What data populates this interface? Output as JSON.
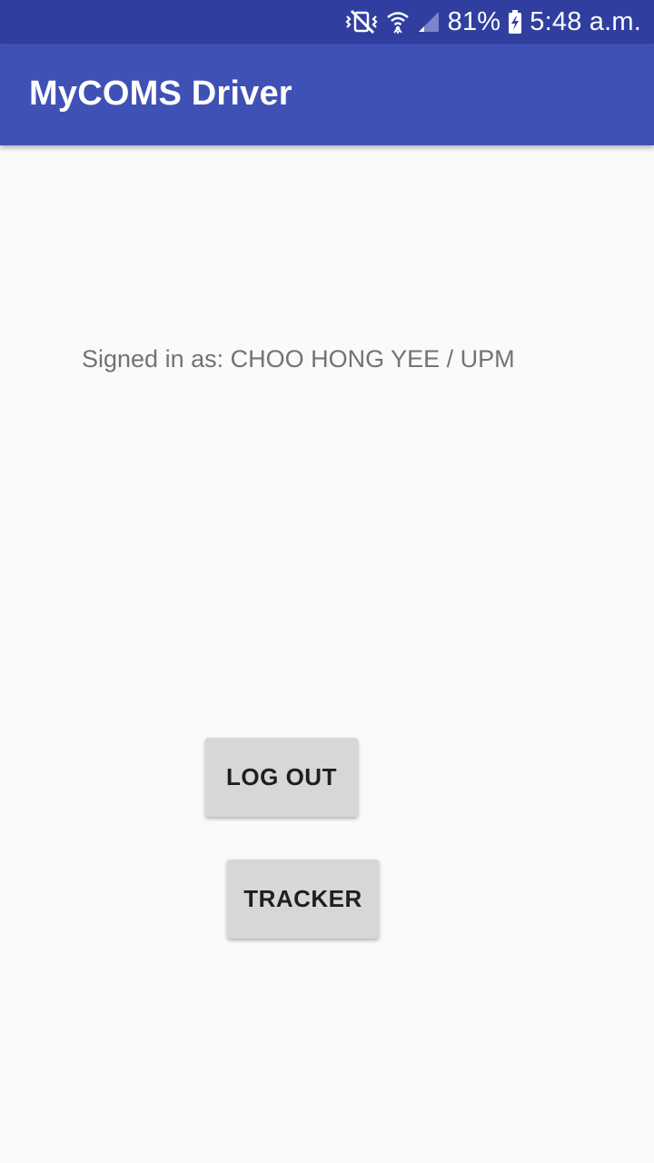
{
  "status_bar": {
    "battery_percent": "81%",
    "time": "5:48 a.m.",
    "icons": [
      "vibrate-mute-icon",
      "wifi-icon",
      "cellular-signal-icon",
      "battery-charging-icon"
    ]
  },
  "app_bar": {
    "title": "MyCOMS Driver"
  },
  "main": {
    "signed_in_text": "Signed in as: CHOO HONG YEE / UPM",
    "logout_label": "LOG OUT",
    "tracker_label": "TRACKER"
  },
  "colors": {
    "status_bar": "#303f9f",
    "app_bar": "#3f51b5",
    "background": "#fafafa",
    "button": "#d6d7d7"
  }
}
